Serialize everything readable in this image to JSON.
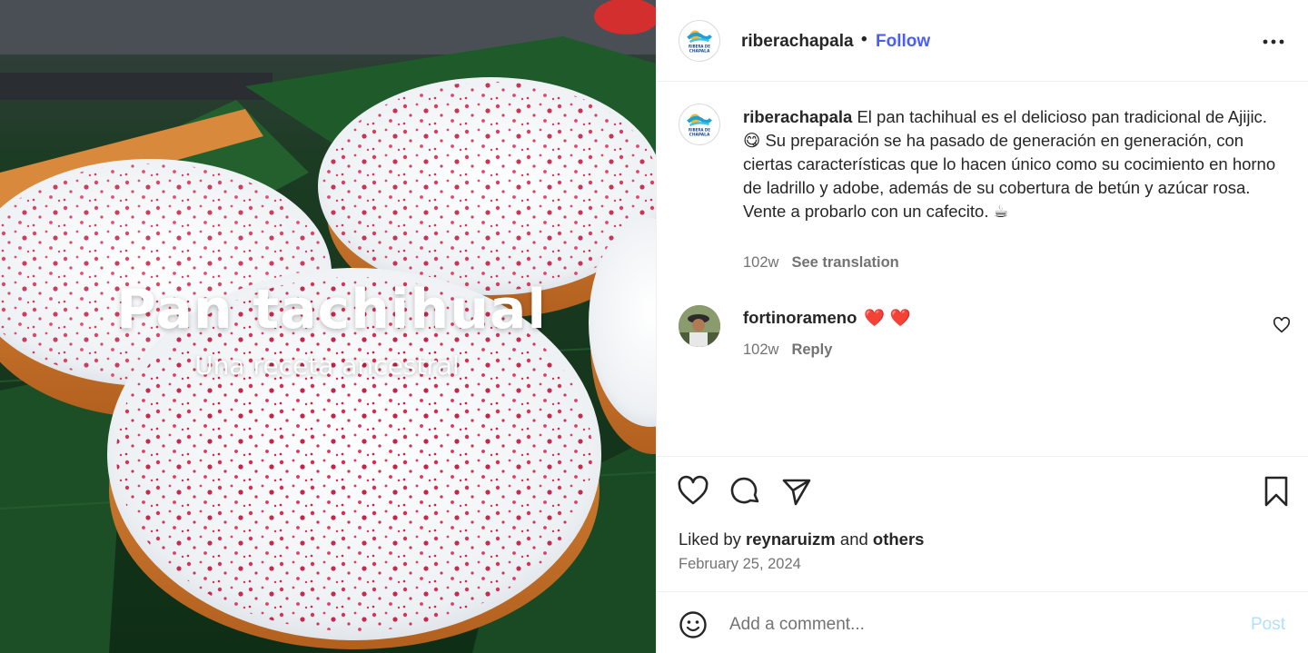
{
  "media": {
    "title": "Pan tachihual",
    "subtitle": "Una receta ancestral"
  },
  "header": {
    "username": "riberachapala",
    "separator": "•",
    "follow_label": "Follow",
    "more_icon": "more-horizontal-icon"
  },
  "avatar": {
    "logo_text_1": "RIBERA DE",
    "logo_text_2": "CHAPALA"
  },
  "caption": {
    "username": "riberachapala",
    "text_1": "El pan tachihual es el delicioso pan tradicional de Ajijic.",
    "emoji_1": "😋",
    "text_2": "Su preparación se ha pasado de generación en generación, con ciertas características que lo hacen único como su cocimiento en horno de ladrillo y adobe, además de su cobertura de betún y azúcar rosa. Vente a probarlo con un cafecito.",
    "emoji_2": "☕",
    "time": "102w",
    "translate_label": "See translation"
  },
  "comment": {
    "username": "fortinorameno",
    "text": "❤️ ❤️",
    "time": "102w",
    "reply_label": "Reply"
  },
  "actions": {
    "like_icon": "heart-icon",
    "comment_icon": "comment-icon",
    "share_icon": "send-icon",
    "save_icon": "bookmark-icon"
  },
  "likes": {
    "prefix": "Liked by",
    "user": "reynaruizm",
    "middle": "and",
    "others": "others"
  },
  "date": "February 25, 2024",
  "add_comment": {
    "placeholder": "Add a comment...",
    "post_label": "Post"
  },
  "colors": {
    "follow": "#4a5df9",
    "post_disabled": "#b2dffc",
    "heart": "#ed3f68",
    "frosting": "#f4f6f8",
    "sprinkles": "#d42a4e",
    "leaf": "#1f5a2a"
  }
}
